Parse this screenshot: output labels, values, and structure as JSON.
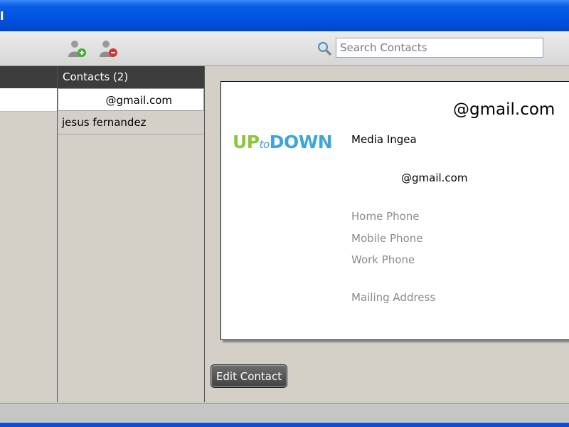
{
  "window": {
    "title_fragment": "l"
  },
  "toolbar": {
    "add_contact_icon": "add-person-icon",
    "remove_contact_icon": "remove-person-icon",
    "search_icon": "search-icon",
    "search_placeholder": "Search Contacts"
  },
  "contacts": {
    "header": "Contacts (2)",
    "items": [
      {
        "label": "@gmail.com",
        "selected": true
      },
      {
        "label": "jesus fernandez",
        "selected": false
      }
    ]
  },
  "card": {
    "email_title": "@gmail.com",
    "logo": {
      "up": "UP",
      "to": "to",
      "down": "DOWN"
    },
    "company": "Media Ingea",
    "email": "@gmail.com",
    "home_phone_label": "Home Phone",
    "mobile_phone_label": "Mobile Phone",
    "work_phone_label": "Work Phone",
    "mailing_address_label": "Mailing Address"
  },
  "actions": {
    "edit_contact_label": "Edit Contact"
  },
  "colors": {
    "titlebar": "#0054e3",
    "header_dark": "#3c3c3c",
    "logo_green": "#8cc63f",
    "logo_blue": "#3da5dc"
  }
}
